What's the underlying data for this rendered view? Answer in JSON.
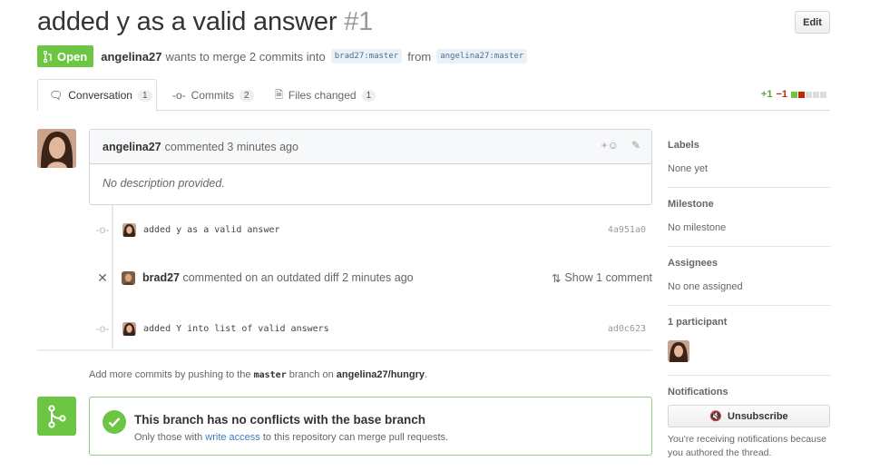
{
  "pr": {
    "title": "added y as a valid answer",
    "number": "#1",
    "edit_label": "Edit",
    "state_label": "Open",
    "author": "angelina27",
    "merge_text": "wants to merge 2 commits into",
    "base_ref": "brad27:master",
    "from_text": "from",
    "head_ref": "angelina27:master"
  },
  "tabs": [
    {
      "label": "Conversation",
      "count": "1"
    },
    {
      "label": "Commits",
      "count": "2"
    },
    {
      "label": "Files changed",
      "count": "1"
    }
  ],
  "diffstat": {
    "additions": "+1",
    "deletions": "−1"
  },
  "comment": {
    "author": "angelina27",
    "action": "commented 3 minutes ago",
    "body": "No description provided."
  },
  "timeline": {
    "commit1": {
      "message": "added y as a valid answer",
      "sha": "4a951a0"
    },
    "review": {
      "author": "brad27",
      "text": "commented on an outdated diff 2 minutes ago",
      "show_label": "Show 1 comment"
    },
    "commit2": {
      "message": "added Y into list of valid answers",
      "sha": "ad0c623"
    }
  },
  "push_note": {
    "prefix": "Add more commits by pushing to the",
    "branch": "master",
    "middle": "branch on",
    "repo": "angelina27/hungry",
    "suffix": "."
  },
  "merge": {
    "title": "This branch has no conflicts with the base branch",
    "sub_prefix": "Only those with",
    "sub_link": "write access",
    "sub_suffix": "to this repository can merge pull requests."
  },
  "sidebar": {
    "labels_title": "Labels",
    "labels_value": "None yet",
    "milestone_title": "Milestone",
    "milestone_value": "No milestone",
    "assignees_title": "Assignees",
    "assignees_value": "No one assigned",
    "participants_title": "1 participant",
    "notifications_title": "Notifications",
    "unsubscribe_label": "Unsubscribe",
    "notifications_note": "You're receiving notifications because you authored the thread."
  },
  "colors": {
    "open_green": "#6cc644",
    "link_blue": "#4078c0",
    "add_green": "#55a532",
    "del_red": "#bd2c00"
  }
}
